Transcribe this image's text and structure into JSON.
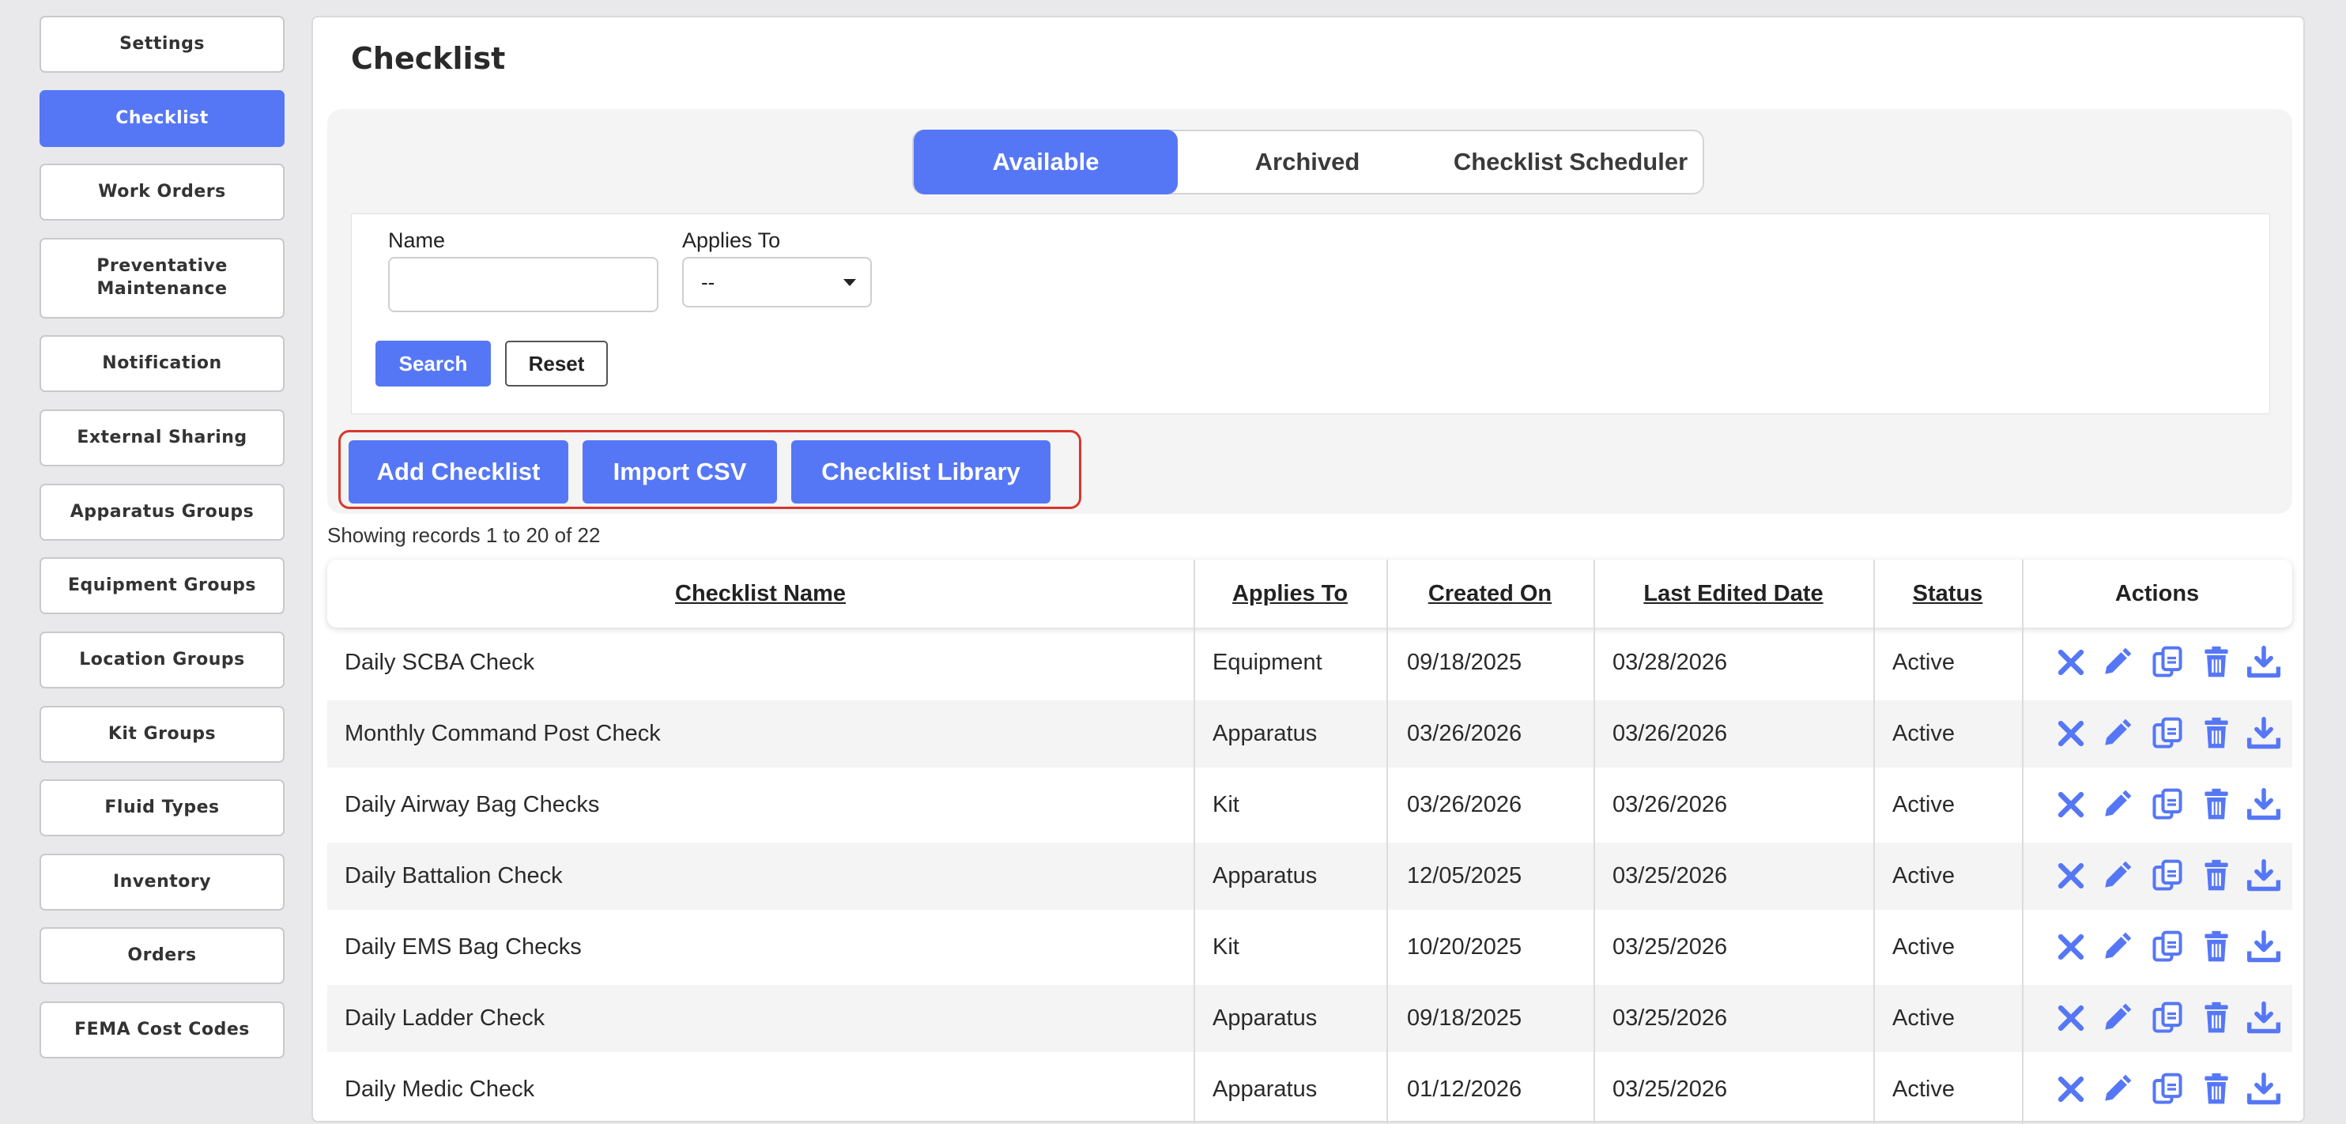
{
  "sidebar": {
    "items": [
      {
        "label": "Settings"
      },
      {
        "label": "Checklist"
      },
      {
        "label": "Work Orders"
      },
      {
        "label": "Preventative Maintenance"
      },
      {
        "label": "Notification"
      },
      {
        "label": "External Sharing"
      },
      {
        "label": "Apparatus Groups"
      },
      {
        "label": "Equipment Groups"
      },
      {
        "label": "Location Groups"
      },
      {
        "label": "Kit Groups"
      },
      {
        "label": "Fluid Types"
      },
      {
        "label": "Inventory"
      },
      {
        "label": "Orders"
      },
      {
        "label": "FEMA Cost Codes"
      }
    ],
    "active": "Checklist"
  },
  "page": {
    "title": "Checklist"
  },
  "tabs": [
    {
      "label": "Available"
    },
    {
      "label": "Archived"
    },
    {
      "label": "Checklist Scheduler"
    }
  ],
  "filters": {
    "name_label": "Name",
    "name_value": "",
    "applies_to_label": "Applies To",
    "applies_to_value": "--",
    "search_label": "Search",
    "reset_label": "Reset"
  },
  "actions": {
    "add": "Add Checklist",
    "import": "Import CSV",
    "library": "Checklist Library"
  },
  "records_text": "Showing records 1 to 20 of 22",
  "table": {
    "columns": [
      "Checklist Name",
      "Applies To",
      "Created On",
      "Last Edited Date",
      "Status",
      "Actions"
    ],
    "rows": [
      {
        "name": "Daily SCBA Check",
        "applies_to": "Equipment",
        "created": "09/18/2025",
        "edited": "03/28/2026",
        "status": "Active"
      },
      {
        "name": "Monthly Command Post Check",
        "applies_to": "Apparatus",
        "created": "03/26/2026",
        "edited": "03/26/2026",
        "status": "Active"
      },
      {
        "name": "Daily Airway Bag Checks",
        "applies_to": "Kit",
        "created": "03/26/2026",
        "edited": "03/26/2026",
        "status": "Active"
      },
      {
        "name": "Daily Battalion Check",
        "applies_to": "Apparatus",
        "created": "12/05/2025",
        "edited": "03/25/2026",
        "status": "Active"
      },
      {
        "name": "Daily EMS Bag Checks",
        "applies_to": "Kit",
        "created": "10/20/2025",
        "edited": "03/25/2026",
        "status": "Active"
      },
      {
        "name": "Daily Ladder Check",
        "applies_to": "Apparatus",
        "created": "09/18/2025",
        "edited": "03/25/2026",
        "status": "Active"
      },
      {
        "name": "Daily Medic Check",
        "applies_to": "Apparatus",
        "created": "01/12/2026",
        "edited": "03/25/2026",
        "status": "Active"
      }
    ]
  },
  "colors": {
    "accent": "#5677f5",
    "highlight_border": "#d9362b"
  },
  "icons": [
    "archive-x-icon",
    "edit-pencil-icon",
    "copy-icon",
    "trash-icon",
    "download-icon"
  ]
}
